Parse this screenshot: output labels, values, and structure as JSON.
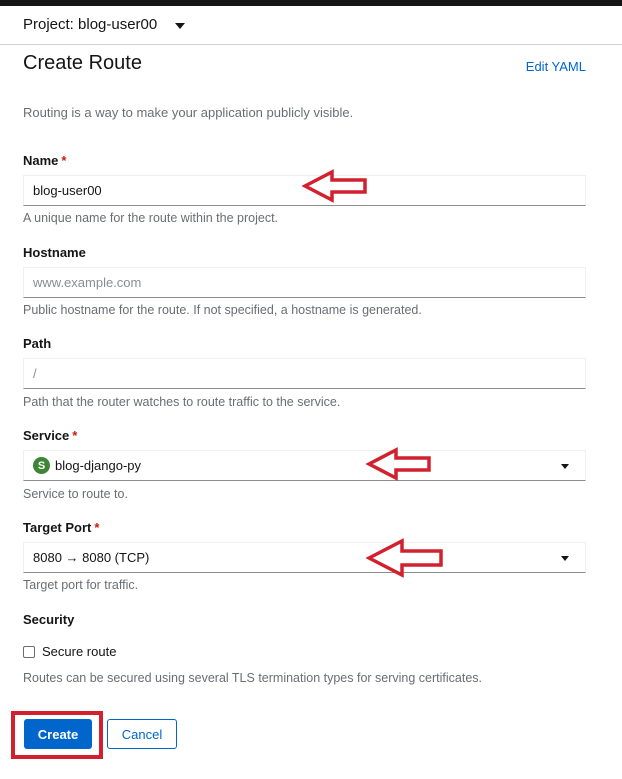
{
  "header": {
    "project_label": "Project: blog-user00"
  },
  "page": {
    "title": "Create Route",
    "edit_yaml": "Edit YAML",
    "intro": "Routing is a way to make your application publicly visible."
  },
  "form": {
    "name": {
      "label": "Name",
      "required_mark": "*",
      "value": "blog-user00",
      "helper": "A unique name for the route within the project."
    },
    "hostname": {
      "label": "Hostname",
      "placeholder": "www.example.com",
      "helper": "Public hostname for the route. If not specified, a hostname is generated."
    },
    "path": {
      "label": "Path",
      "placeholder": "/",
      "helper": "Path that the router watches to route traffic to the service."
    },
    "service": {
      "label": "Service",
      "required_mark": "*",
      "badge": "S",
      "value": "blog-django-py",
      "helper": "Service to route to."
    },
    "target_port": {
      "label": "Target Port",
      "required_mark": "*",
      "value": "8080 → 8080 (TCP)",
      "helper": "Target port for traffic."
    },
    "security": {
      "label": "Security",
      "checkbox_label": "Secure route",
      "helper": "Routes can be secured using several TLS termination types for serving certificates."
    }
  },
  "actions": {
    "create": "Create",
    "cancel": "Cancel"
  },
  "colors": {
    "primary": "#0066cc",
    "annotation": "#d2202f",
    "service_badge": "#3e8635"
  }
}
